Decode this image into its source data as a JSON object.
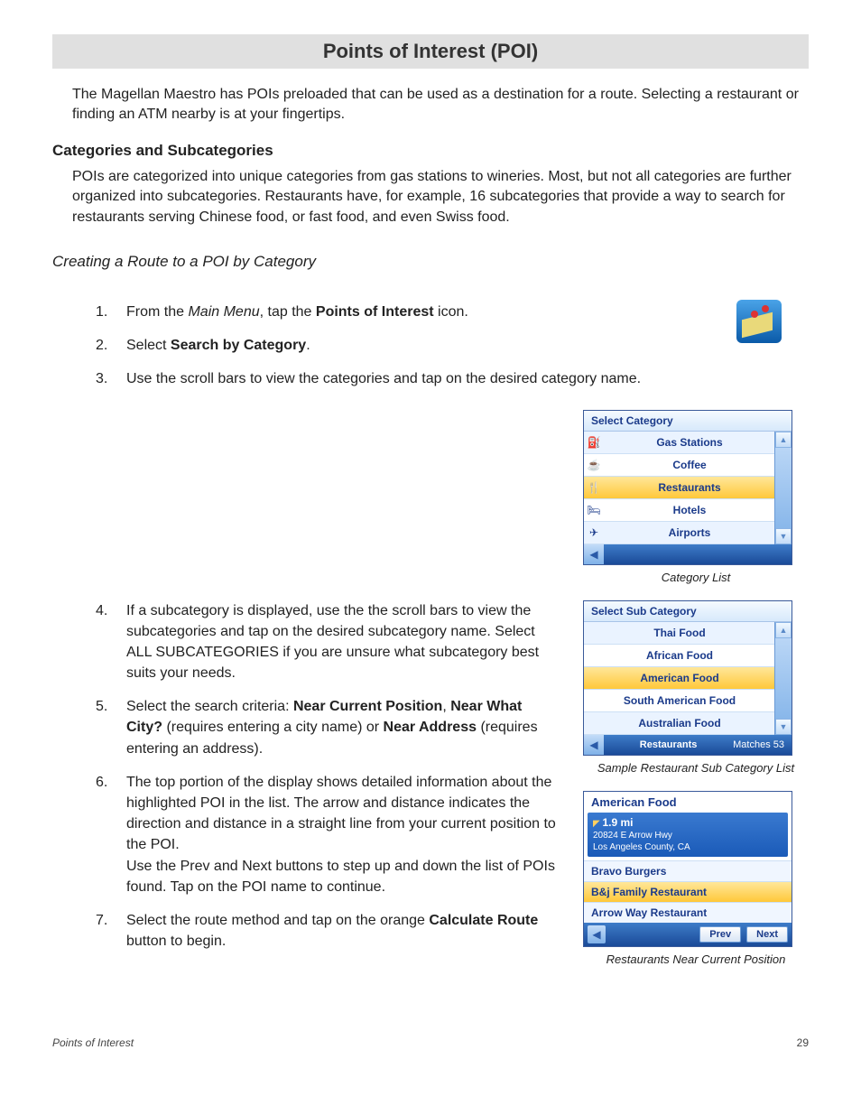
{
  "title": "Points of Interest (POI)",
  "intro": "The Magellan Maestro has POIs preloaded that can be used as a destination for a route.  Selecting a restaurant or finding an ATM nearby is at your fingertips.",
  "section1_heading": "Categories and Subcategories",
  "section1_body": "POIs are categorized into unique categories from gas stations to wineries.  Most, but not all categories are further organized into subcategories.  Restaurants have, for example, 16 subcategories that provide a way to search for restaurants serving Chinese food, or fast food, and even Swiss food.",
  "sub_heading": "Creating a Route to a POI by Category",
  "steps": {
    "s1_pre": "From the ",
    "s1_i": "Main Menu",
    "s1_mid": ", tap the ",
    "s1_b": "Points of Interest",
    "s1_post": " icon.",
    "s2_pre": "Select ",
    "s2_b": "Search by Category",
    "s2_post": ".",
    "s3": "Use the scroll bars to view the categories and tap on the desired category name.",
    "s4": "If a subcategory is displayed, use the the scroll bars to view the subcategories and tap on the desired subcategory name.  Select ALL SUBCATEGORIES if you are unsure what subcategory best suits your needs.",
    "s5_pre": "Select the search criteria: ",
    "s5_b1": "Near Current Position",
    "s5_mid1": ", ",
    "s5_b2": "Near What City?",
    "s5_mid2": " (requires entering a city name) or ",
    "s5_b3": "Near Address",
    "s5_post": " (requires entering an address).",
    "s6": "The top portion of the display shows detailed information about the highlighted POI in the list.  The arrow and distance indicates the direction and distance in a straight line from your current position to the POI.\nUse the Prev and Next buttons to step up and down the list of POIs found.  Tap on the POI name to continue.",
    "s7_pre": "Select the route method and tap on the orange ",
    "s7_b": "Calculate Route",
    "s7_post": " button to begin."
  },
  "cat_screen": {
    "header": "Select Category",
    "items": [
      {
        "icon": "⛽",
        "label": "Gas Stations"
      },
      {
        "icon": "☕",
        "label": "Coffee"
      },
      {
        "icon": "🍴",
        "label": "Restaurants"
      },
      {
        "icon": "🛏",
        "label": "Hotels"
      },
      {
        "icon": "✈",
        "label": "Airports"
      }
    ],
    "caption": "Category List"
  },
  "sub_screen": {
    "header": "Select Sub Category",
    "items": [
      "Thai Food",
      "African Food",
      "American Food",
      "South American Food",
      "Australian Food"
    ],
    "footer_mid": "Restaurants",
    "footer_right": "Matches  53",
    "caption": "Sample  Restaurant Sub Category List"
  },
  "res_screen": {
    "title": "American Food",
    "distance": "1.9 mi",
    "addr1": "20824 E Arrow Hwy",
    "addr2": "Los Angeles County, CA",
    "rows": [
      "Bravo Burgers",
      "B&j Family Restaurant",
      "Arrow Way Restaurant"
    ],
    "btn_prev": "Prev",
    "btn_next": "Next",
    "caption": "Restaurants Near Current Position"
  },
  "footer_left": "Points of Interest",
  "footer_right": "29"
}
